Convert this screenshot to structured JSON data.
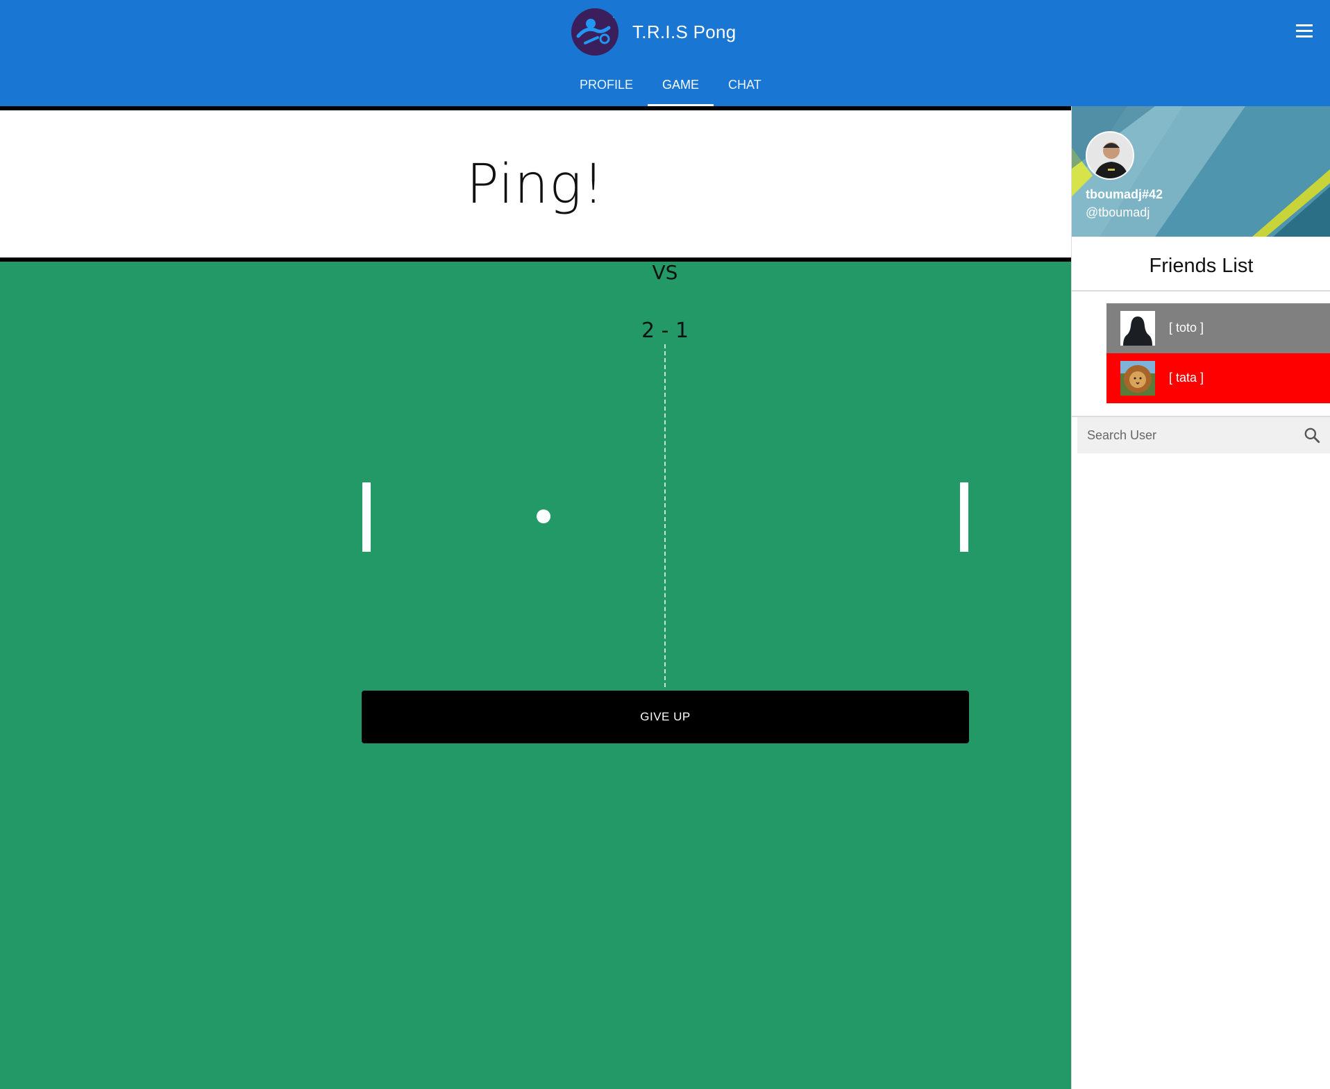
{
  "header": {
    "title": "T.R.I.S Pong",
    "tabs": [
      {
        "label": "PROFILE",
        "active": false
      },
      {
        "label": "GAME",
        "active": true
      },
      {
        "label": "CHAT",
        "active": false
      }
    ],
    "menu_icon": "hamburger-menu-icon",
    "color": "#1976d2"
  },
  "game": {
    "banner": "Ping!",
    "vs": "VS",
    "score": "2 - 1",
    "give_up_label": "GIVE UP",
    "field_color": "#229966"
  },
  "sidebar": {
    "profile": {
      "name": "tboumadj#42",
      "handle": "@tboumadj"
    },
    "friends_title": "Friends List",
    "friends": [
      {
        "name": "[ toto ]",
        "status_color": "#808080"
      },
      {
        "name": "[ tata ]",
        "status_color": "#ff0000"
      }
    ],
    "search": {
      "placeholder": "Search User",
      "icon": "search-icon"
    }
  }
}
